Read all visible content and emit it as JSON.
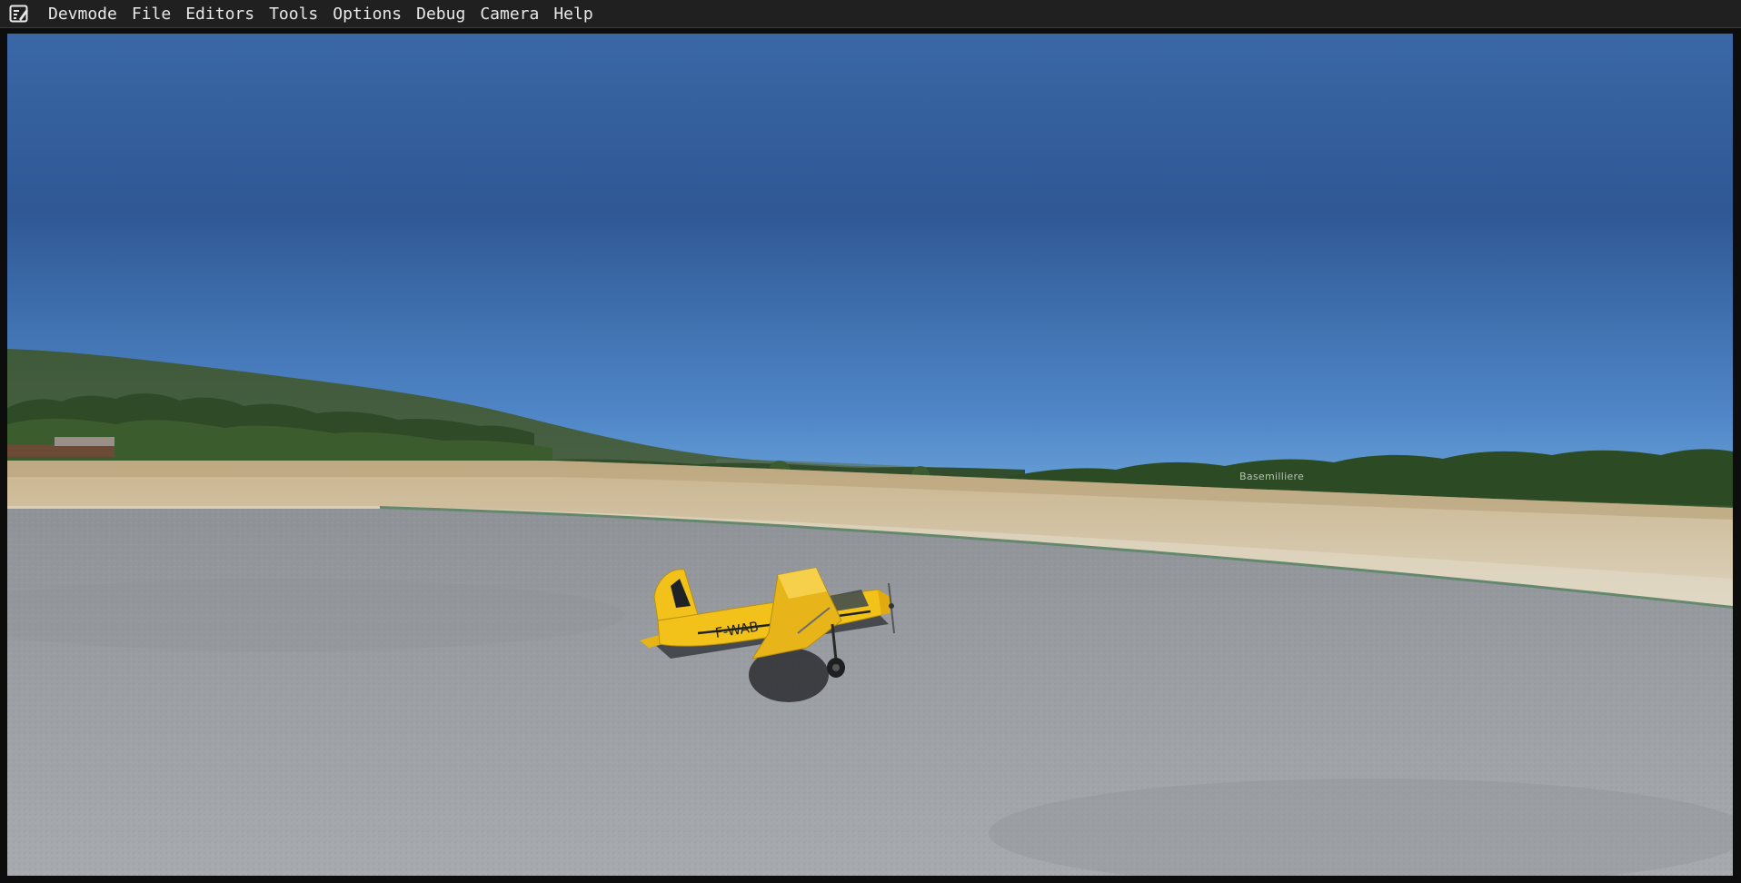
{
  "menubar": {
    "icon": "devmode-edit-icon",
    "items": [
      {
        "label": "Devmode"
      },
      {
        "label": "File"
      },
      {
        "label": "Editors"
      },
      {
        "label": "Tools"
      },
      {
        "label": "Options"
      },
      {
        "label": "Debug"
      },
      {
        "label": "Camera"
      },
      {
        "label": "Help"
      }
    ]
  },
  "scene": {
    "aircraft_registration": "F-WAB",
    "aircraft_color": "#f2c21b",
    "sky_top_color": "#2f5894",
    "sky_horizon_color": "#6ea7dc",
    "ground_color": "#9a9ea3",
    "waypoint_label": "Basemilliere"
  }
}
